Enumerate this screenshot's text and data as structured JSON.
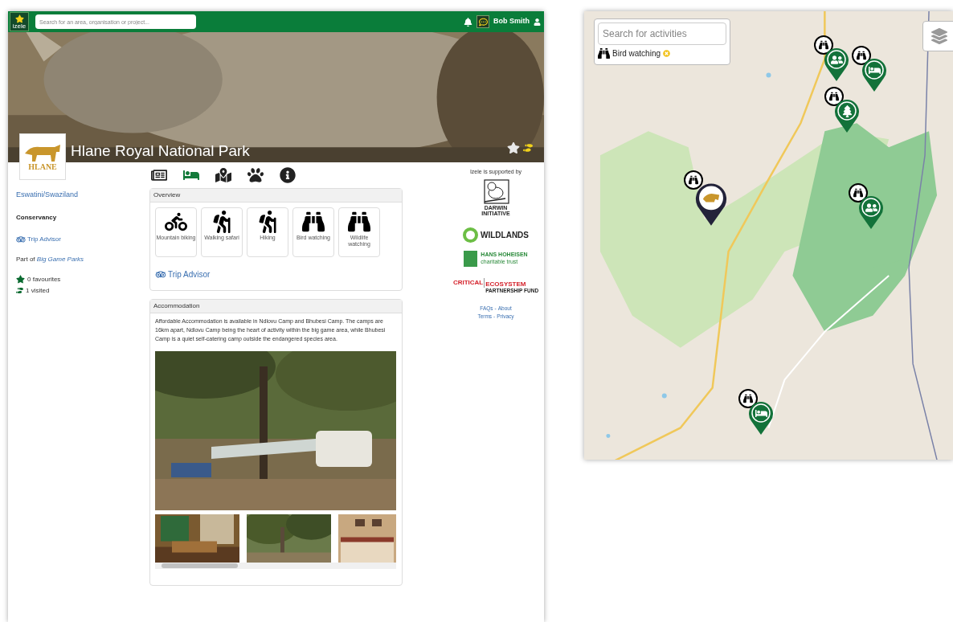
{
  "header": {
    "logo_text": "izele",
    "search": {
      "placeholder": "Search for an area, organisation or project..."
    },
    "user": "Bob Smith"
  },
  "park": {
    "title": "Hlane Royal National Park",
    "logo_text": "HLANE"
  },
  "sidebar": {
    "country": "Eswatini/Swaziland",
    "type": "Conservancy",
    "tripadvisor": "Trip Advisor",
    "part_of_prefix": "Part of",
    "part_of_link": "Big Game Parks",
    "favourites": "0 favourites",
    "visited": "1 visited"
  },
  "section_tabs": [
    {
      "kind": "news",
      "selected": false
    },
    {
      "kind": "accommodation",
      "selected": true
    },
    {
      "kind": "map",
      "selected": false
    },
    {
      "kind": "wildlife",
      "selected": false
    },
    {
      "kind": "info",
      "selected": false
    }
  ],
  "overview": {
    "title": "Overview",
    "activities": [
      {
        "kind": "biking",
        "label": "Mountain biking"
      },
      {
        "kind": "hiking",
        "label": "Walking safari"
      },
      {
        "kind": "hiking",
        "label": "Hiking"
      },
      {
        "kind": "binoculars",
        "label": "Bird watching"
      },
      {
        "kind": "binoculars",
        "label": "Wildlife watching"
      }
    ],
    "tripadvisor": "Trip Advisor"
  },
  "accommodation": {
    "title": "Accommodation",
    "text": "Affordable Accommodation is available in Ndlovu Camp and Bhubesi Camp. The camps are 16km apart, Ndlovu Camp being the heart of activity within the big game area, while Bhubesi Camp is a quiet self-catering camp outside the endangered species area."
  },
  "supporters": {
    "heading": "Izele is supported by",
    "darwin": [
      "DARWIN",
      "INITIATIVE"
    ],
    "wildlands": "WILDLANDS",
    "hans": [
      "HANS HOHEISEN",
      "charitable trust"
    ],
    "cepf": [
      "CRITICAL",
      "ECOSYSTEM",
      "PARTNERSHIP FUND"
    ],
    "links": [
      [
        "FAQs",
        "About"
      ],
      [
        "Terms",
        "Privacy"
      ]
    ],
    "separator": "-"
  },
  "map": {
    "search": {
      "placeholder": "Search for activities"
    },
    "filter": {
      "label": "Bird watching"
    },
    "markers": [
      {
        "kind": "people"
      },
      {
        "kind": "accommodation"
      },
      {
        "kind": "tree"
      },
      {
        "kind": "park"
      },
      {
        "kind": "people"
      },
      {
        "kind": "accommodation"
      }
    ]
  }
}
